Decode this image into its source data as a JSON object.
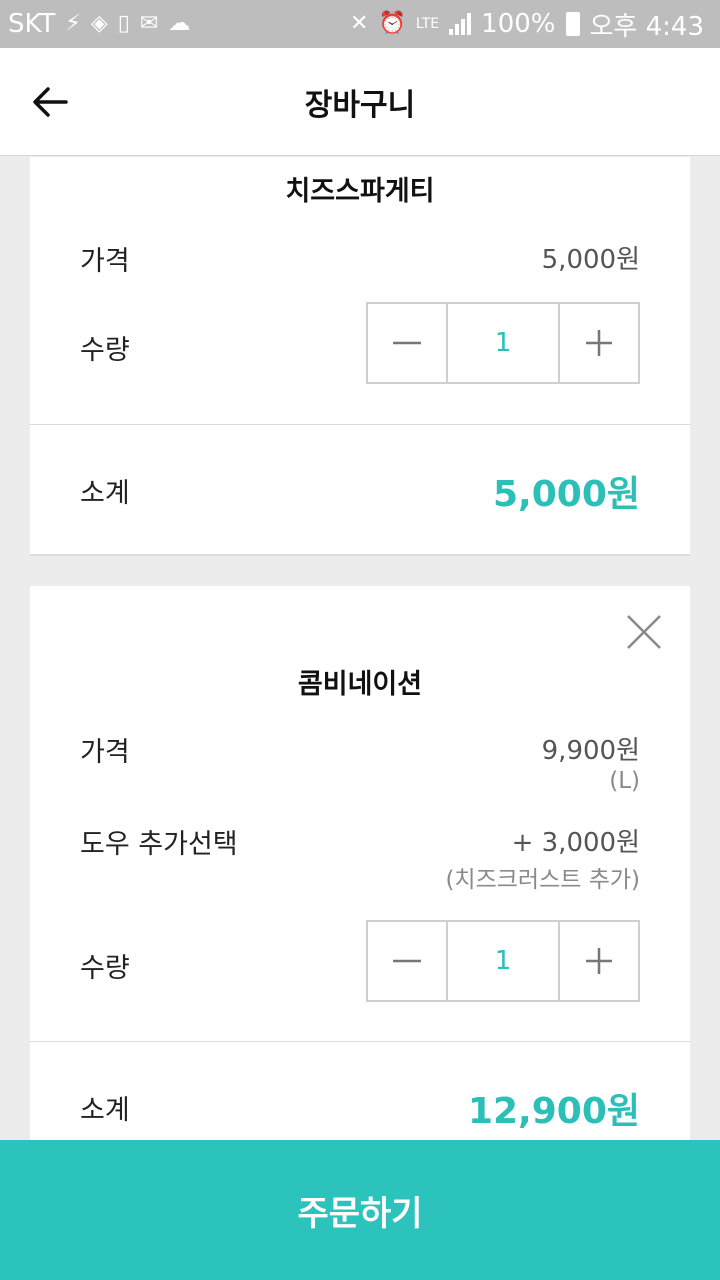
{
  "status_bar": {
    "carrier": "SKT",
    "network": "LTE",
    "battery": "100%",
    "time": "오후 4:43"
  },
  "header": {
    "title": "장바구니",
    "back_icon": "arrow-left-icon"
  },
  "cart_items": [
    {
      "name": "치즈스파게티",
      "price_label": "가격",
      "price": "5,000원",
      "quantity_label": "수량",
      "quantity": "1",
      "subtotal_label": "소계",
      "subtotal": "5,000원"
    },
    {
      "name": "콤비네이션",
      "price_label": "가격",
      "price": "9,900원",
      "size": "(L)",
      "option_label": "도우 추가선택",
      "option_price": "+ 3,000원",
      "option_detail": "(치즈크러스트 추가)",
      "quantity_label": "수량",
      "quantity": "1",
      "subtotal_label": "소계",
      "subtotal": "12,900원"
    }
  ],
  "order_button": {
    "label": "주문하기"
  },
  "colors": {
    "accent": "#2bc3bb",
    "status_bar": "#bdbdbd"
  }
}
